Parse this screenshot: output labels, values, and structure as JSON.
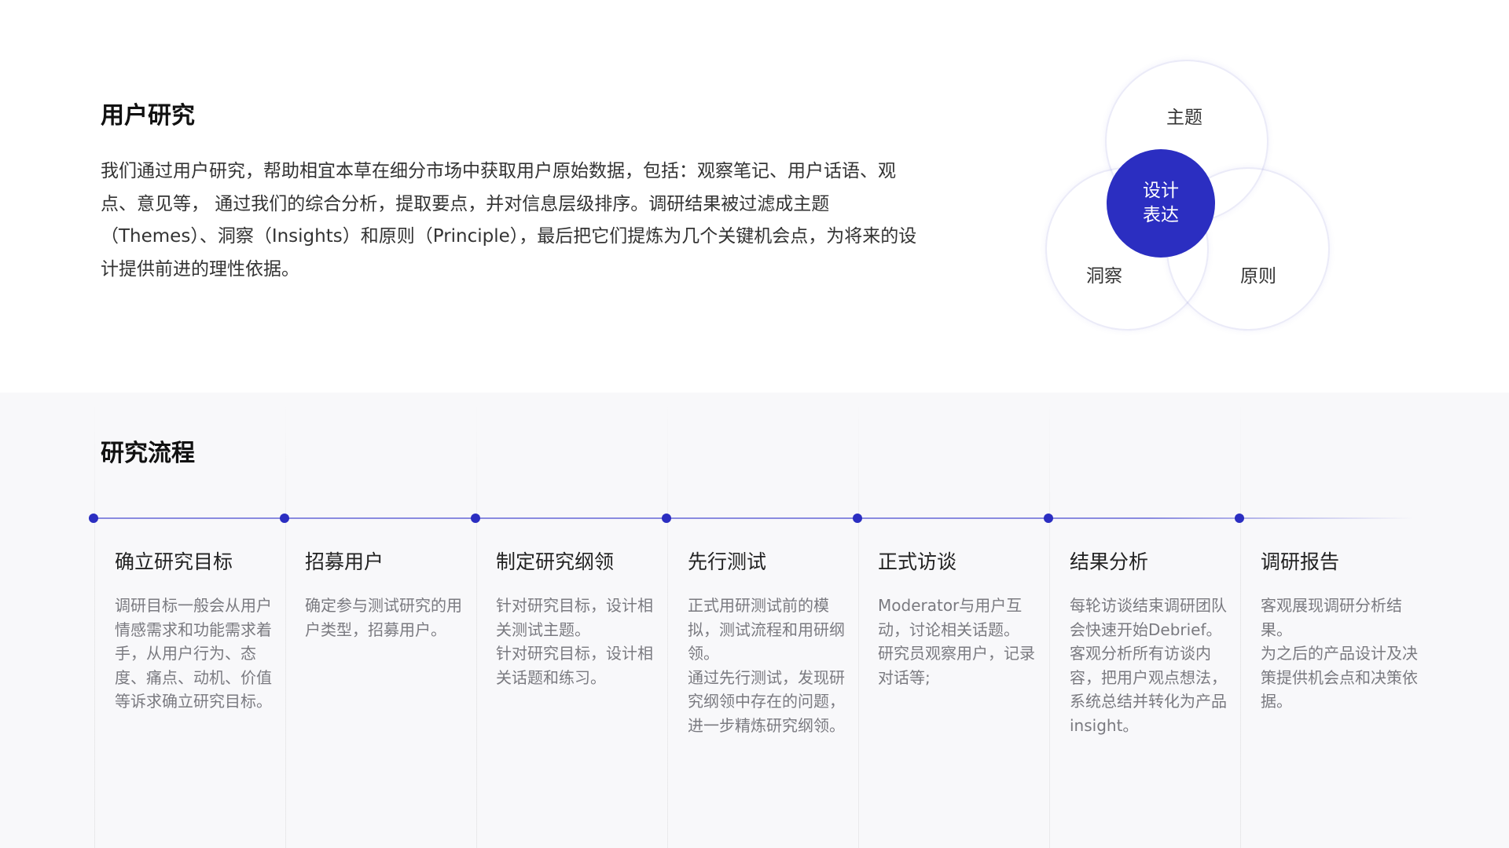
{
  "research": {
    "title": "用户研究",
    "intro": "我们通过用户研究，帮助相宜本草在细分市场中获取用户原始数据，包括：观察笔记、用户话语、观点、意见等， 通过我们的综合分析，提取要点，并对信息层级排序。调研结果被过滤成主题（Themes）、洞察（Insights）和原则（Principle），最后把它们提炼为几个关键机会点，为将来的设计提供前进的理性依据。",
    "venn": {
      "top": "主题",
      "left": "洞察",
      "right": "原则",
      "core": "设计表达"
    },
    "colors": {
      "accent": "#2b2ec1",
      "line": "#8a8be0"
    }
  },
  "process": {
    "title": "研究流程",
    "steps": [
      {
        "title": "确立研究目标",
        "body": "调研目标一般会从用户情感需求和功能需求着手，从用户行为、态度、痛点、动机、价值等诉求确立研究目标。"
      },
      {
        "title": "招募用户",
        "body": "确定参与测试研究的用户类型，招募用户。"
      },
      {
        "title": "制定研究纲领",
        "body": "针对研究目标，设计相关测试主题。\n针对研究目标，设计相关话题和练习。"
      },
      {
        "title": "先行测试",
        "body": "正式用研测试前的模拟，测试流程和用研纲领。\n通过先行测试，发现研究纲领中存在的问题，进一步精炼研究纲领。"
      },
      {
        "title": "正式访谈",
        "body": "Moderator与用户互动，讨论相关话题。\n研究员观察用户，记录对话等;"
      },
      {
        "title": "结果分析",
        "body": "每轮访谈结束调研团队会快速开始Debrief。\n客观分析所有访谈内容，把用户观点想法，系统总结并转化为产品insight。"
      },
      {
        "title": "调研报告",
        "body": "客观展现调研分析结果。\n为之后的产品设计及决策提供机会点和决策依据。"
      }
    ]
  }
}
